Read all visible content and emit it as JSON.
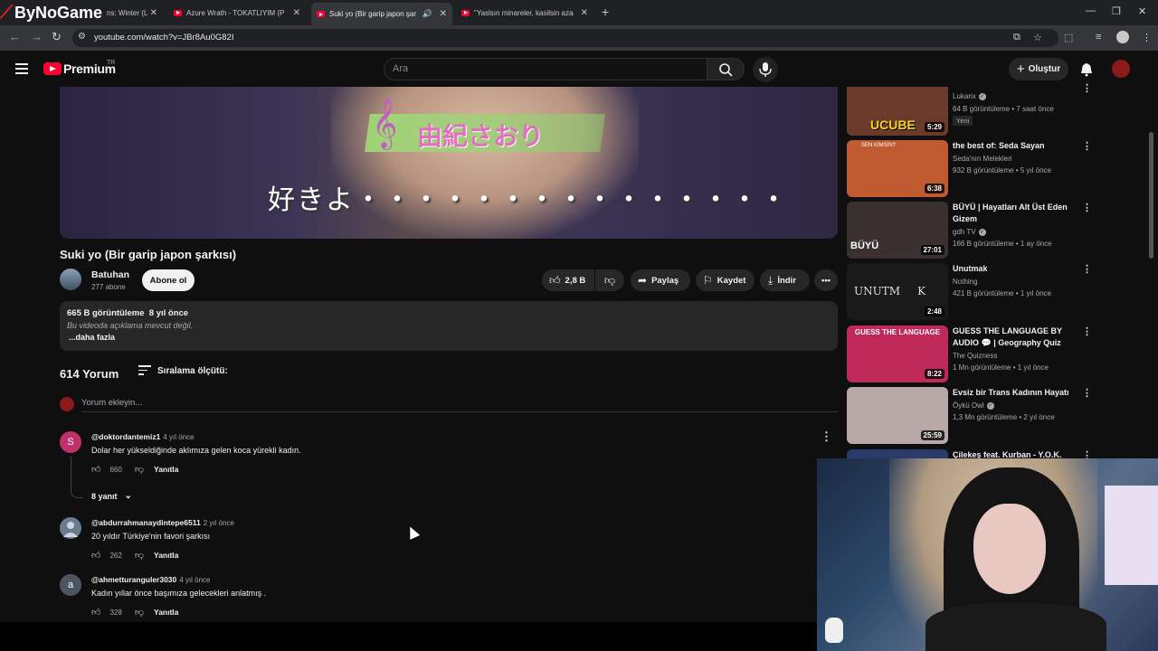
{
  "overlay_brand": "ByNoGame",
  "browser": {
    "tabs": [
      {
        "title": "ns: Winter (L",
        "active": false
      },
      {
        "title": "Azure Wrath - TOKATLIYIM (Pr",
        "active": false
      },
      {
        "title": "Suki yo (Bir garip japon şar",
        "active": true
      },
      {
        "title": "\"Yaslsın minareler, kasilsin azan",
        "active": false
      }
    ],
    "url": "youtube.com/watch?v=JBr8Au0G82I"
  },
  "header": {
    "brand": "Premium",
    "country": "TR",
    "search_placeholder": "Ara",
    "create_label": "Oluştur"
  },
  "video": {
    "overlay_name": "由紀さおり",
    "overlay_lyric": "好きよ・・・・・・・・・・・・・・・",
    "title": "Suki yo (Bir garip japon şarkısı)",
    "channel": "Batuhan",
    "subscribers": "277 abone",
    "subscribe_label": "Abone ol",
    "likes": "2,8 B",
    "share_label": "Paylaş",
    "save_label": "Kaydet",
    "download_label": "İndir"
  },
  "description": {
    "views_date": "665 B görüntüleme  8 yıl önce",
    "body": "Bu videoda açıklama mevcut değil.",
    "more": "...daha fazla"
  },
  "comments": {
    "count_label": "614 Yorum",
    "sort_label": "Sıralama ölçütü:",
    "add_placeholder": "Yorum ekleyin...",
    "reply_label": "Yanıtla",
    "items": [
      {
        "user": "@doktordantemiz1",
        "time": "4 yıl önce",
        "text": "Dolar her yükseldiğinde aklımıza gelen koca yürekli kadın.",
        "likes": "660",
        "avatar_letter": "S",
        "avatar_color": "#c0306a",
        "replies": "8 yanıt"
      },
      {
        "user": "@abdurrahmanaydintepe6511",
        "time": "2 yıl önce",
        "text": "20 yıldır Türkiye'nin favori şarkısı",
        "likes": "262",
        "avatar_letter": "",
        "avatar_color": "#6a7a90"
      },
      {
        "user": "@ahmetturanguler3030",
        "time": "4 yıl önce",
        "text": "Kadın yıllar önce başımıza gelecekleri anlatmış .",
        "likes": "328",
        "avatar_letter": "a",
        "avatar_color": "#4a5560"
      }
    ]
  },
  "sidebar": {
    "items": [
      {
        "title": "",
        "channel": "Lukarix",
        "verified": true,
        "meta": "64 B görüntüleme • 7 saat önce",
        "badge": "Yeni",
        "duration": "5:29",
        "thumb_text": "UCUBE",
        "thumb_bg": "#6a3a2a"
      },
      {
        "title": "the best of: Seda Sayan",
        "channel": "Seda'nın Melekleri",
        "verified": false,
        "meta": "932 B görüntüleme • 5 yıl önce",
        "duration": "6:38",
        "thumb_text": "SEN KİMSİN?",
        "thumb_bg": "#c05a30"
      },
      {
        "title": "BÜYÜ | Hayatları Alt Üst Eden Gizem",
        "channel": "gdh TV",
        "verified": true,
        "meta": "166 B görüntüleme • 1 ay önce",
        "duration": "27:01",
        "thumb_text": "BÜYÜ",
        "thumb_bg": "#3a3030"
      },
      {
        "title": "Unutmak",
        "channel": "Nothing",
        "verified": false,
        "meta": "421 B görüntüleme • 1 yıl önce",
        "duration": "2:48",
        "thumb_text": "UNUTM     K",
        "thumb_bg": "#1a1a1a"
      },
      {
        "title": "GUESS THE LANGUAGE BY AUDIO 💬 | Geography Quiz",
        "channel": "The Quizness",
        "verified": false,
        "meta": "1 Mn görüntüleme • 1 yıl önce",
        "duration": "8:22",
        "thumb_text": "GUESS THE LANGUAGE",
        "thumb_bg": "#c02a5a"
      },
      {
        "title": "Evsiz bir Trans Kadının Hayatı",
        "channel": "Öykü Owl",
        "verified": true,
        "meta": "1,3 Mn görüntüleme • 2 yıl önce",
        "duration": "25:59",
        "thumb_text": "",
        "thumb_bg": "#b8a8a8"
      },
      {
        "title": "Çilekeş feat. Kurban - Y.O.K.",
        "channel": "",
        "verified": false,
        "meta": "",
        "duration": "",
        "thumb_text": "",
        "thumb_bg": "#2a3a6a"
      }
    ]
  }
}
